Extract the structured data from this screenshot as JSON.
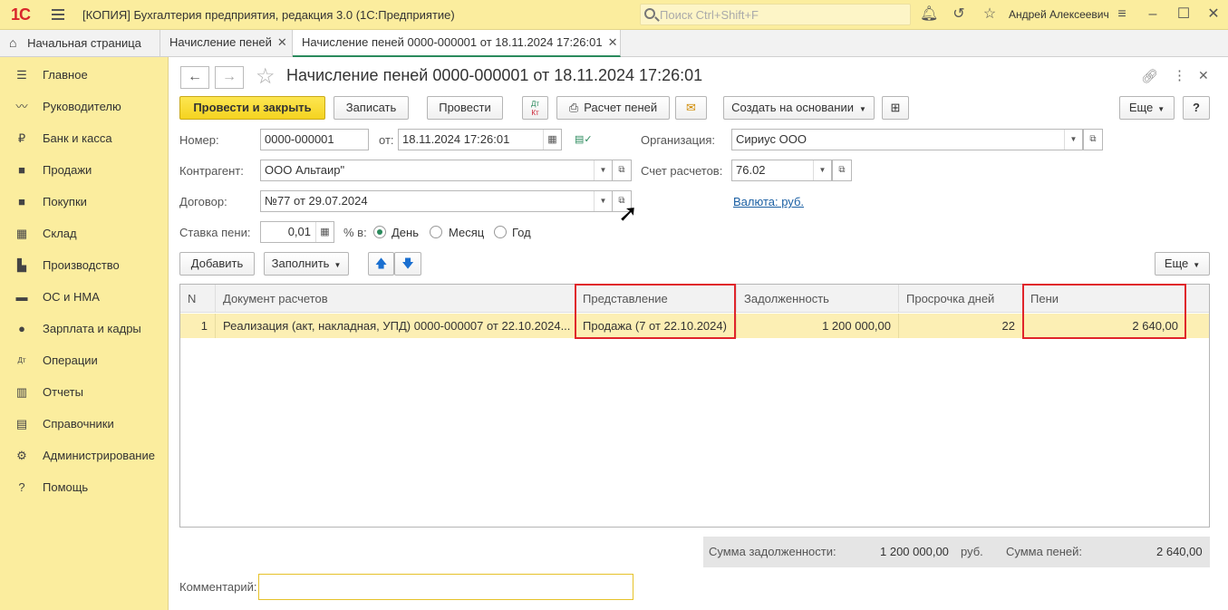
{
  "titlebar": {
    "logo": "1С",
    "title": "[КОПИЯ] Бухгалтерия предприятия, редакция 3.0  (1С:Предприятие)",
    "search_placeholder": "Поиск Ctrl+Shift+F",
    "user": "Андрей Алексеевич"
  },
  "tabs": [
    {
      "label": "Начальная страница"
    },
    {
      "label": "Начисление пеней"
    },
    {
      "label": "Начисление пеней 0000-000001 от 18.11.2024 17:26:01"
    }
  ],
  "sidebar": {
    "items": [
      {
        "label": "Главное",
        "icon": "list-icon"
      },
      {
        "label": "Руководителю",
        "icon": "chart-line-icon"
      },
      {
        "label": "Банк и касса",
        "icon": "coin-icon"
      },
      {
        "label": "Продажи",
        "icon": "bag-icon"
      },
      {
        "label": "Покупки",
        "icon": "cart-icon"
      },
      {
        "label": "Склад",
        "icon": "warehouse-icon"
      },
      {
        "label": "Производство",
        "icon": "factory-icon"
      },
      {
        "label": "ОС и НМА",
        "icon": "truck-icon"
      },
      {
        "label": "Зарплата и кадры",
        "icon": "person-icon"
      },
      {
        "label": "Операции",
        "icon": "dt-kt-icon"
      },
      {
        "label": "Отчеты",
        "icon": "bar-chart-icon"
      },
      {
        "label": "Справочники",
        "icon": "books-icon"
      },
      {
        "label": "Администрирование",
        "icon": "gear-icon"
      },
      {
        "label": "Помощь",
        "icon": "question-icon"
      }
    ]
  },
  "document": {
    "title": "Начисление пеней 0000-000001 от 18.11.2024 17:26:01"
  },
  "toolbar": {
    "post_close": "Провести и закрыть",
    "save": "Записать",
    "post": "Провести",
    "dtkt_dt": "Дт",
    "dtkt_kt": "Кт",
    "calc_penalty": "Расчет пеней",
    "create_based": "Создать на основании",
    "more": "Еще",
    "help": "?"
  },
  "form": {
    "number_label": "Номер:",
    "number": "0000-000001",
    "date_label": "от:",
    "date": "18.11.2024 17:26:01",
    "org_label": "Организация:",
    "org": "Сириус ООО",
    "contractor_label": "Контрагент:",
    "contractor": "ООО Альтаир\"",
    "account_label": "Счет расчетов:",
    "account": "76.02",
    "contract_label": "Договор:",
    "contract": "№77 от 29.07.2024",
    "currency_link": "Валюта: руб.",
    "rate_label": "Ставка пени:",
    "rate": "0,01",
    "percent_label": "% в:",
    "period_options": [
      "День",
      "Месяц",
      "Год"
    ],
    "period_selected": "День"
  },
  "table_toolbar": {
    "add": "Добавить",
    "fill": "Заполнить",
    "more": "Еще"
  },
  "table": {
    "columns": [
      "N",
      "Документ расчетов",
      "Представление",
      "Задолженность",
      "Просрочка дней",
      "Пени"
    ],
    "rows": [
      [
        "1",
        "Реализация (акт, накладная, УПД) 0000-000007 от 22.10.2024...",
        "Продажа (7 от 22.10.2024)",
        "1 200 000,00",
        "22",
        "2 640,00"
      ]
    ]
  },
  "totals": {
    "debt_label": "Сумма задолженности:",
    "debt": "1 200 000,00",
    "currency": "руб.",
    "penalty_label": "Сумма пеней:",
    "penalty": "2 640,00"
  },
  "comment": {
    "label": "Комментарий:",
    "value": ""
  },
  "colors": {
    "titlebar": "#fbed9e",
    "primary_button": "#f5d320",
    "highlight_box": "#e0242b",
    "selected_row": "#fcefb4"
  }
}
